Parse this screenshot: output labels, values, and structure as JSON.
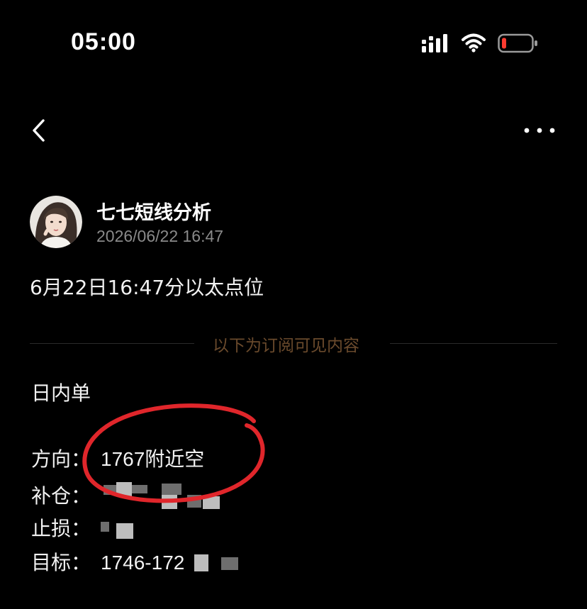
{
  "status_bar": {
    "time": "05:00",
    "icons": [
      "signal-icon",
      "wifi-icon",
      "battery-icon"
    ],
    "battery_color": "#ff3b30"
  },
  "nav": {
    "back_icon": "chevron-left-icon",
    "more_icon": "more-horizontal-icon"
  },
  "author": {
    "name": "七七短线分析",
    "timestamp": "2026/06/22 16:47"
  },
  "post": {
    "title": "6月22日16:47分以太点位",
    "divider_label": "以下为订阅可见内容",
    "section": "日内单",
    "fields": [
      {
        "label": "方向：",
        "value": "1767附近空"
      },
      {
        "label": "补仓：",
        "value": ""
      },
      {
        "label": "止损：",
        "value": ""
      },
      {
        "label": "目标：",
        "value": "1746-172"
      }
    ]
  },
  "colors": {
    "background": "#000000",
    "text": "#f2f2f2",
    "muted": "#8a8a8a",
    "divider_text": "#6a4a2c",
    "annotation": "#e0262b"
  }
}
